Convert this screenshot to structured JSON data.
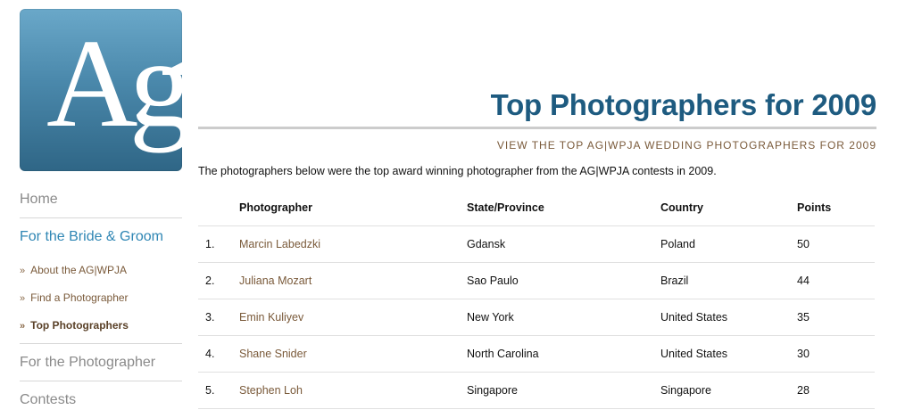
{
  "logo": {
    "text": "Ag",
    "brand_color": "#4a88ab"
  },
  "sidebar": {
    "home": "Home",
    "bride_groom": "For the Bride & Groom",
    "sub_items": [
      {
        "label": "About the AG|WPJA"
      },
      {
        "label": "Find a Photographer"
      },
      {
        "label": "Top Photographers"
      }
    ],
    "for_photographer": "For the Photographer",
    "contests": "Contests"
  },
  "main": {
    "title": "Top Photographers for 2009",
    "subtitle": "VIEW THE TOP AG|WPJA WEDDING PHOTOGRAPHERS FOR 2009",
    "intro": "The photographers below were the top award winning photographer from the AG|WPJA contests in 2009."
  },
  "table": {
    "headers": {
      "photographer": "Photographer",
      "state": "State/Province",
      "country": "Country",
      "points": "Points"
    },
    "rows": [
      {
        "rank": "1.",
        "photographer": "Marcin Labedzki",
        "state": "Gdansk",
        "country": "Poland",
        "points": "50"
      },
      {
        "rank": "2.",
        "photographer": "Juliana Mozart",
        "state": "Sao Paulo",
        "country": "Brazil",
        "points": "44"
      },
      {
        "rank": "3.",
        "photographer": "Emin Kuliyev",
        "state": "New York",
        "country": "United States",
        "points": "35"
      },
      {
        "rank": "4.",
        "photographer": "Shane Snider",
        "state": "North Carolina",
        "country": "United States",
        "points": "30"
      },
      {
        "rank": "5.",
        "photographer": "Stephen Loh",
        "state": "Singapore",
        "country": "Singapore",
        "points": "28"
      }
    ]
  },
  "colors": {
    "title": "#1e5b80",
    "link_brown": "#7a5a3a",
    "active_blue": "#2f86b4"
  }
}
